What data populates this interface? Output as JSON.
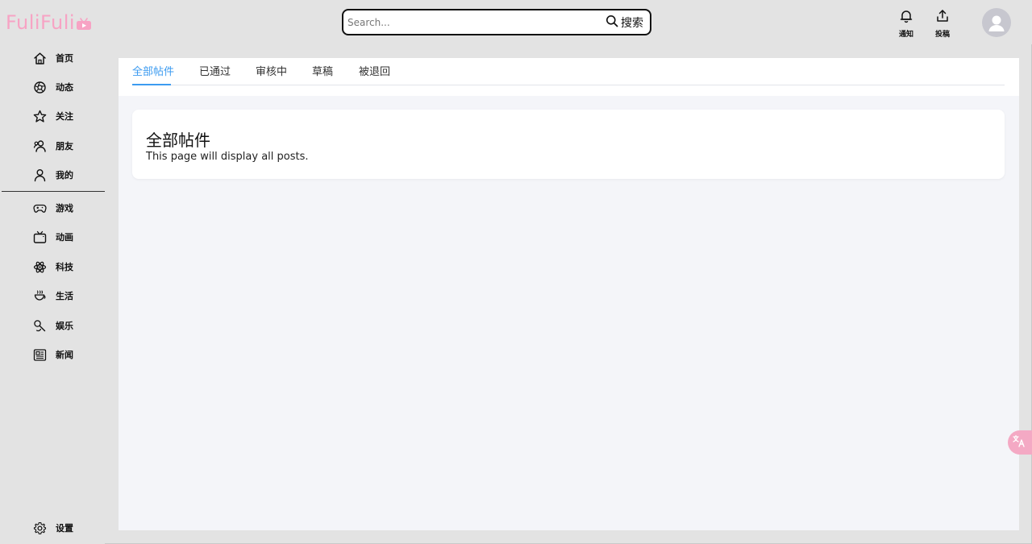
{
  "app": {
    "logo_text": "FuliFuli",
    "brand_color": "#f7a3c4"
  },
  "search": {
    "placeholder": "Search...",
    "button_label": "搜索",
    "icon": "search-icon"
  },
  "header_actions": {
    "notify_label": "通知",
    "notify_icon": "bell-icon",
    "upload_label": "投稿",
    "upload_icon": "upload-icon",
    "avatar_icon": "user-avatar-icon"
  },
  "sidebar": {
    "primary": [
      {
        "label": "首页",
        "icon": "home-icon"
      },
      {
        "label": "动态",
        "icon": "aperture-icon"
      },
      {
        "label": "关注",
        "icon": "star-icon"
      },
      {
        "label": "朋友",
        "icon": "friends-icon"
      },
      {
        "label": "我的",
        "icon": "user-icon"
      }
    ],
    "categories": [
      {
        "label": "游戏",
        "icon": "gamepad-icon"
      },
      {
        "label": "动画",
        "icon": "tv-icon"
      },
      {
        "label": "科技",
        "icon": "atom-icon"
      },
      {
        "label": "生活",
        "icon": "cup-icon"
      },
      {
        "label": "娱乐",
        "icon": "microphone-icon"
      },
      {
        "label": "新闻",
        "icon": "newspaper-icon"
      }
    ],
    "settings": {
      "label": "设置",
      "icon": "gear-icon"
    }
  },
  "tabs": {
    "items": [
      {
        "label": "全部帖件",
        "active": true
      },
      {
        "label": "已通过",
        "active": false
      },
      {
        "label": "审核中",
        "active": false
      },
      {
        "label": "草稿",
        "active": false
      },
      {
        "label": "被退回",
        "active": false
      }
    ],
    "accent_color": "#3c9bf0"
  },
  "content": {
    "title": "全部帖件",
    "description": "This page will display all posts."
  },
  "floating": {
    "translate_icon": "translate-icon",
    "color": "#f4a9c4"
  }
}
